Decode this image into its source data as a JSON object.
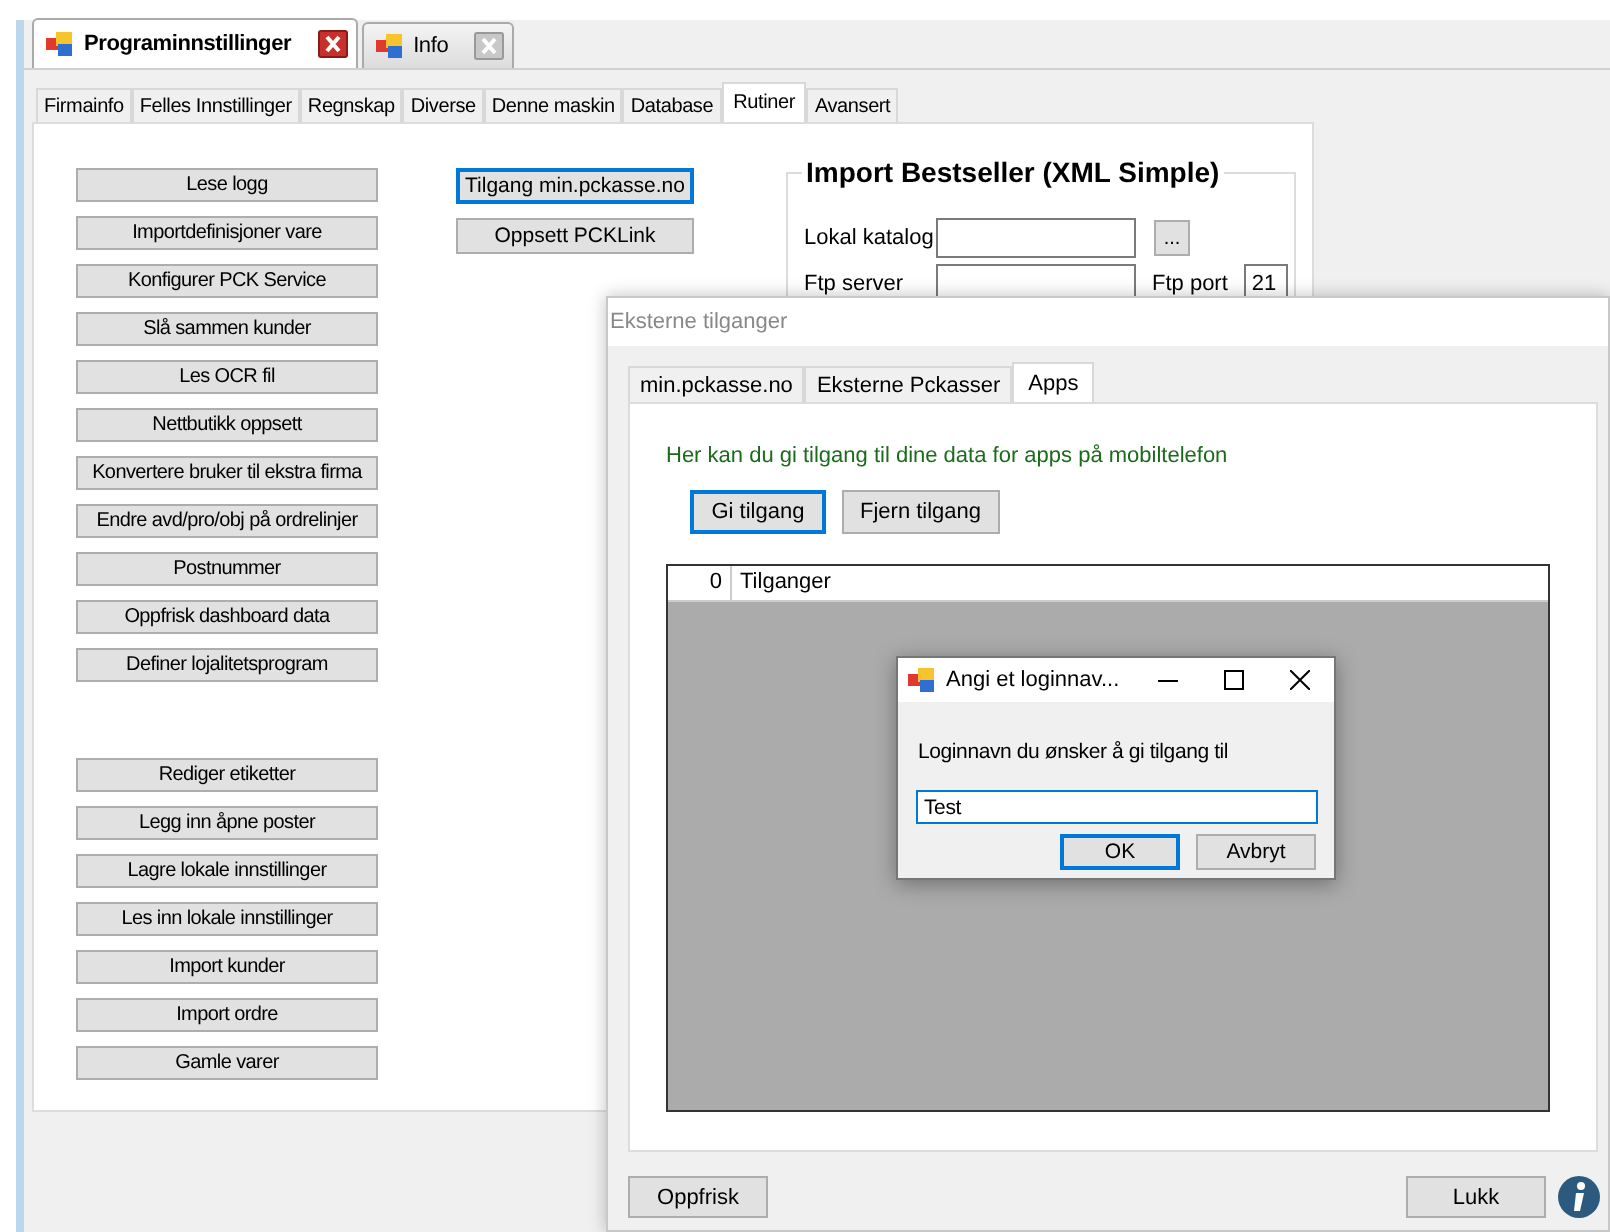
{
  "document_tabs": [
    {
      "label": "Programinnstillinger",
      "selected": true
    },
    {
      "label": "Info",
      "selected": false
    }
  ],
  "settings_tabs": [
    {
      "label": "Firmainfo",
      "selected": false
    },
    {
      "label": "Felles Innstillinger",
      "selected": false
    },
    {
      "label": "Regnskap",
      "selected": false
    },
    {
      "label": "Diverse",
      "selected": false
    },
    {
      "label": "Denne maskin",
      "selected": false
    },
    {
      "label": "Database",
      "selected": false
    },
    {
      "label": "Rutiner",
      "selected": true
    },
    {
      "label": "Avansert",
      "selected": false
    }
  ],
  "routine_buttons_top": [
    "Lese logg",
    "Importdefinisjoner vare",
    "Konfigurer PCK Service",
    "Slå sammen kunder",
    "Les OCR fil",
    "Nettbutikk oppsett",
    "Konvertere bruker til ekstra firma",
    "Endre avd/pro/obj på ordrelinjer",
    "Postnummer",
    "Oppfrisk dashboard data",
    "Definer lojalitetsprogram"
  ],
  "routine_buttons_bottom": [
    "Rediger etiketter",
    "Legg inn åpne poster",
    "Lagre lokale innstillinger",
    "Les inn  lokale innstillinger",
    "Import kunder",
    "Import ordre",
    "Gamle varer"
  ],
  "middle_buttons": [
    {
      "label": "Tilgang min.pckasse.no",
      "focused": true
    },
    {
      "label": "Oppsett PCKLink",
      "focused": false
    }
  ],
  "import_group": {
    "title": "Import Bestseller (XML Simple)",
    "local_folder_label": "Lokal katalog",
    "browse_button": "...",
    "ftp_server_label": "Ftp server",
    "ftp_port_label": "Ftp port",
    "ftp_port_value": "21"
  },
  "access_dialog": {
    "title": "Eksterne tilganger",
    "tabs": [
      {
        "label": "min.pckasse.no",
        "selected": false
      },
      {
        "label": "Eksterne Pckasser",
        "selected": false
      },
      {
        "label": "Apps",
        "selected": true
      }
    ],
    "info_text": "Her kan du gi tilgang til dine data for apps på mobiltelefon",
    "buttons": [
      {
        "label": "Gi tilgang",
        "focused": true
      },
      {
        "label": "Fjern tilgang",
        "focused": false
      }
    ],
    "grid": {
      "row_header": "0",
      "column": "Tilganger"
    },
    "refresh_button": "Oppfrisk",
    "close_button": "Lukk"
  },
  "login_dialog": {
    "title": "Angi et loginnav...",
    "prompt": "Loginnavn du ønsker å gi tilgang til",
    "value": "Test",
    "buttons": [
      {
        "label": "OK",
        "focused": true
      },
      {
        "label": "Avbryt",
        "focused": false
      }
    ]
  }
}
